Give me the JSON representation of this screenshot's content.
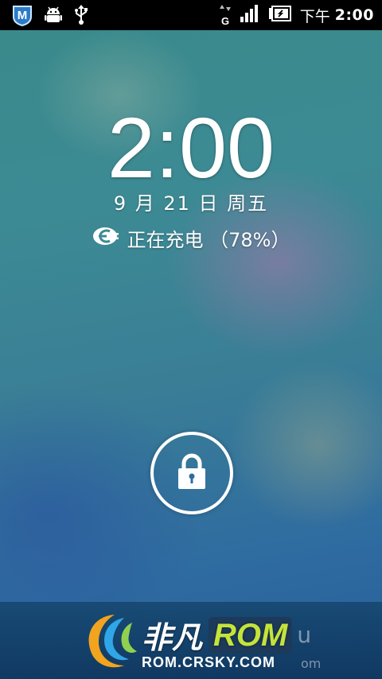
{
  "status_bar": {
    "ampm": "下午",
    "time": "2:00",
    "network_type": "G",
    "icons_left": [
      "shield-m-icon",
      "android-debug-icon",
      "usb-icon"
    ],
    "icons_right": [
      "data-activity-icon",
      "signal-icon",
      "battery-charging-icon"
    ]
  },
  "lockscreen": {
    "clock": "2:00",
    "date": "9 月 21 日 周五",
    "charging_text": "正在充电 （78%）",
    "battery_percent": 78
  },
  "watermark": {
    "brand_cn": "非凡",
    "brand_rom": "ROM",
    "brand_faded": "u",
    "url": "ROM.CRSKY.COM",
    "url_faded": "om"
  },
  "colors": {
    "status_bar_bg": "#000000",
    "rom_green": "#c5e33a"
  }
}
